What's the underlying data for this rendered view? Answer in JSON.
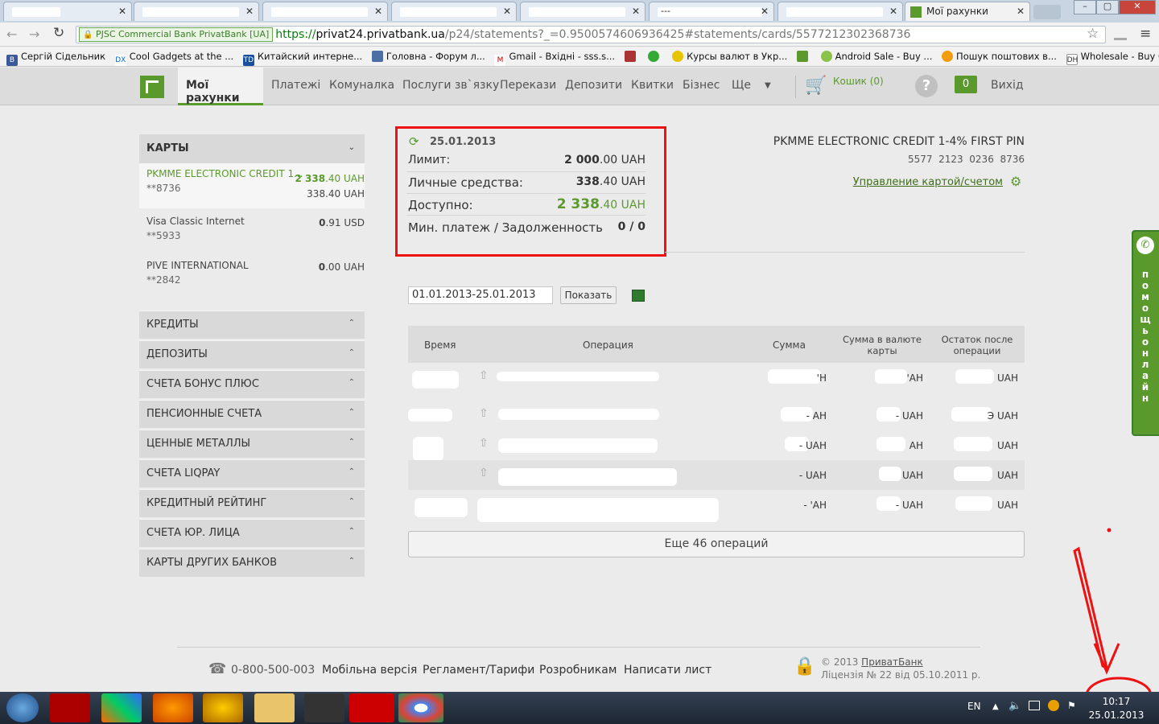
{
  "browser": {
    "active_tab": "Мої рахунки",
    "ev_label": "PJSC Commercial Bank PrivatBank [UA]",
    "url_scheme": "https://",
    "url_domain": "privat24.privatbank.ua",
    "url_path": "/p24/statements?_=0.9500574606936425#statements/cards/5577212302368736",
    "bookmarks": [
      "Сергій Сідельник",
      "Cool Gadgets at the ...",
      "Китайский интерне...",
      "Головна - Форум л...",
      "Gmail - Вхідні - sss.s...",
      "Курсы валют в Укр...",
      "Android Sale - Buy ...",
      "Пошук поштових в...",
      "Wholesale - Buy Chi..."
    ],
    "tab_dash": "---"
  },
  "nav": {
    "items": [
      "Мої рахунки",
      "Платежі",
      "Комуналка",
      "Послуги зв`язку",
      "Перекази",
      "Депозити",
      "Квитки",
      "Бізнес",
      "Ще"
    ],
    "cart": "Кошик (0)",
    "badge": "0",
    "logout": "Вихід"
  },
  "sidebar": {
    "cards_title": "КАРТЫ",
    "cards": [
      {
        "name": "PKMME ELECTRONIC CREDIT 1...",
        "num": "**8736",
        "bal_int": "2 338",
        "bal_frac": ".40 UAH",
        "sub": "338.40 UAH"
      },
      {
        "name": "Visa Classic Internet",
        "num": "**5933",
        "bal_int": "0",
        "bal_frac": ".91 USD",
        "sub": ""
      },
      {
        "name": "PIVE INTERNATIONAL",
        "num": "**2842",
        "bal_int": "0",
        "bal_frac": ".00 UAH",
        "sub": ""
      }
    ],
    "sections": [
      "КРЕДИТЫ",
      "ДЕПОЗИТЫ",
      "СЧЕТА БОНУС ПЛЮС",
      "ПЕНСИОННЫЕ СЧЕТА",
      "ЦЕННЫЕ МЕТАЛЛЫ",
      "СЧЕТА LIQPAY",
      "КРЕДИТНЫЙ РЕЙТИНГ",
      "СЧЕТА ЮР. ЛИЦА",
      "КАРТЫ ДРУГИХ БАНКОВ"
    ]
  },
  "info": {
    "date": "25.01.2013",
    "limit_label": "Лимит:",
    "limit_int": "2 000",
    "limit_frac": ".00 UAH",
    "own_label": "Личные средства:",
    "own_int": "338",
    "own_frac": ".40 UAH",
    "avail_label": "Доступно:",
    "avail_int": "2 338",
    "avail_frac": ".40 UAH",
    "min_label": "Мин. платеж / Задолженность",
    "min_value": "0 / 0"
  },
  "card": {
    "title": "PKMME ELECTRONIC CREDIT 1-4% FIRST PIN",
    "number": "5577  2123  0236  8736",
    "manage": "Управление картой/счетом"
  },
  "filter": {
    "period": "01.01.2013-25.01.2013",
    "show": "Показать"
  },
  "table": {
    "headers": [
      "Время",
      "Операция",
      "Сумма",
      "Сумма в валюте карты",
      "Остаток после операции"
    ],
    "rows": [
      {
        "sum": "'Н",
        "card": "'АН",
        "rest": "UAH"
      },
      {
        "sum": "- АН",
        "card": "- UAH",
        "rest": "Э UAH"
      },
      {
        "sum": "- UAH",
        "card": "АН",
        "rest": "UAH"
      },
      {
        "sum": "- UAH",
        "card": "UAH",
        "rest": "UAH"
      },
      {
        "sum": "- 'АН",
        "card": "- UAH",
        "rest": "UAH"
      }
    ],
    "more": "Еще 46 операций"
  },
  "help": "помощь онлайн",
  "footer": {
    "phone": "0-800-500-003",
    "links": [
      "Мобільна версія",
      "Регламент/Тарифи",
      "Розробникам",
      "Написати лист"
    ],
    "copy": "© 2013 ",
    "copy_link": "ПриватБанк",
    "license": "Ліцензія № 22 від 05.10.2011 р."
  },
  "taskbar": {
    "lang": "EN",
    "time": "10:17",
    "date": "25.01.2013"
  }
}
